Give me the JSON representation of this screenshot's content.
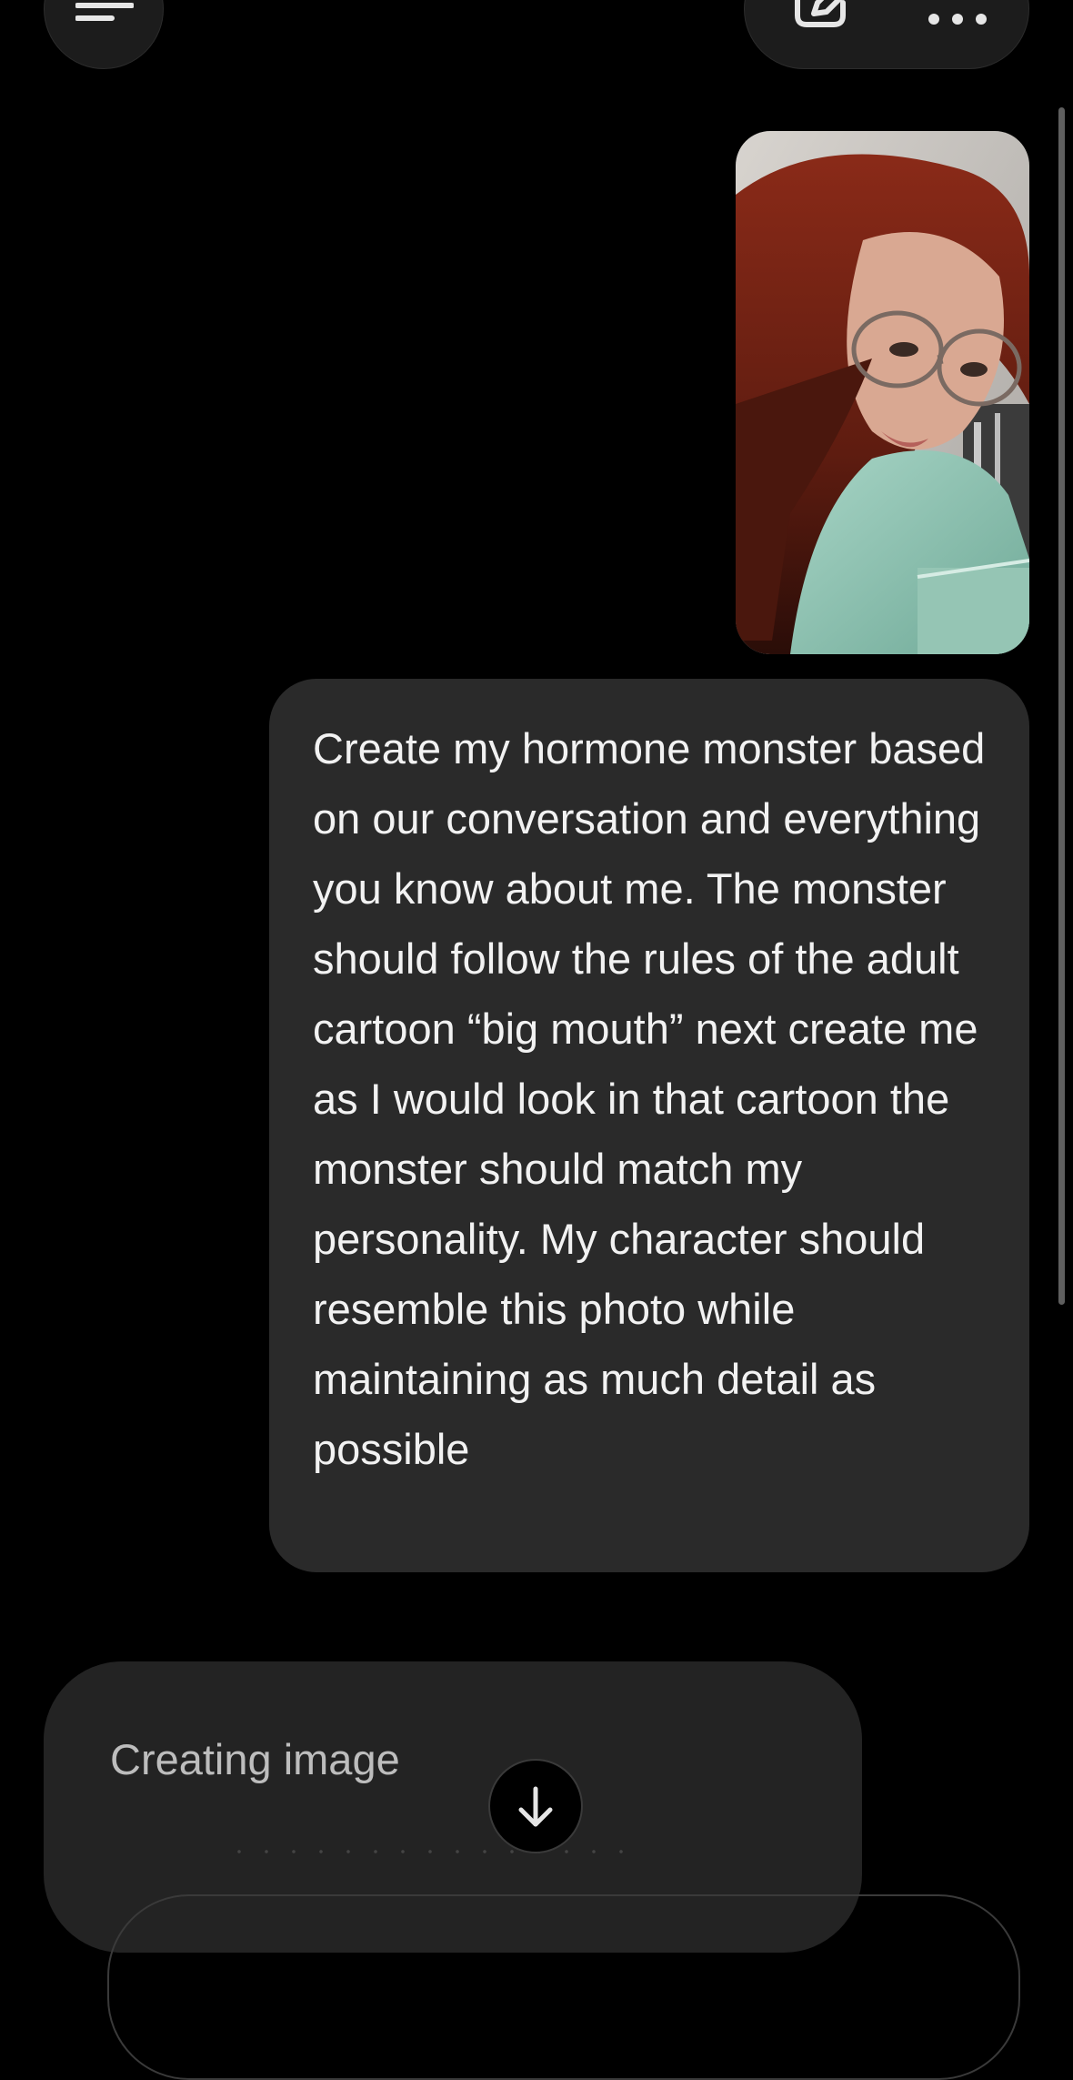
{
  "header": {
    "menu_icon": "hamburger-menu-icon",
    "edit_icon": "compose-edit-icon",
    "more_icon": "more-horizontal-icon"
  },
  "conversation": {
    "user_message": "Create my hormone monster based on our conversation and everything you know about me. The monster should follow the rules of the adult cartoon “big mouth” next create me as I would look in that cartoon the monster should match my personality. My character should resemble this photo while maintaining as much detail as possible",
    "assistant_status": "Creating image"
  },
  "scroll_down_icon": "arrow-down-icon",
  "colors": {
    "background": "#000000",
    "bubble": "#2a2a2a",
    "card": "#232323",
    "text": "#f2f2f2",
    "muted_text": "#bdbdbd"
  }
}
